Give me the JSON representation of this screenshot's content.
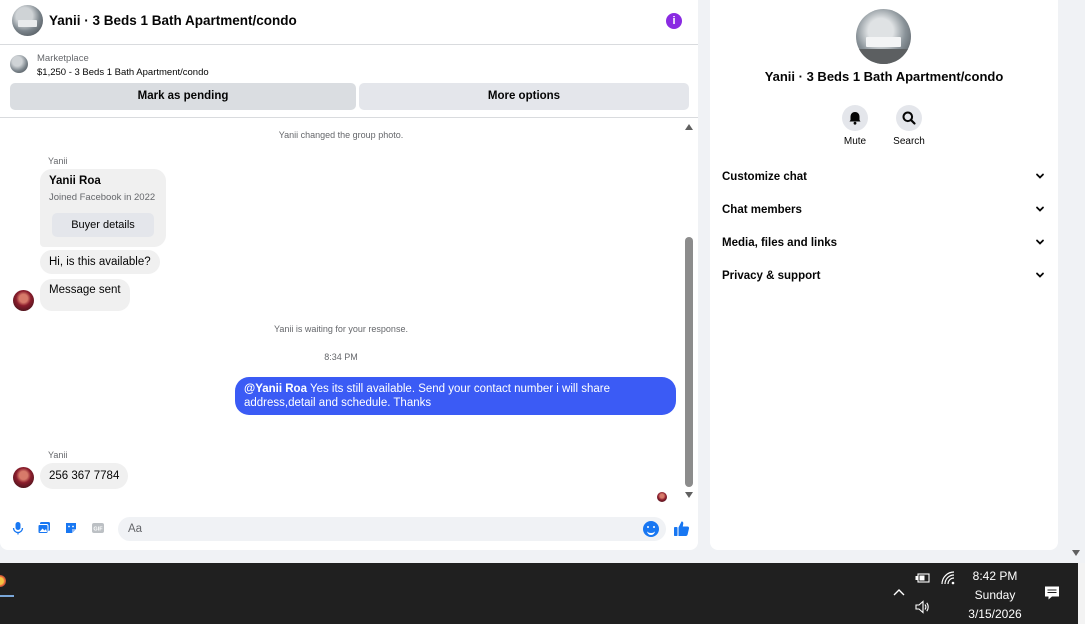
{
  "chat": {
    "title": "Yanii · 3 Beds 1 Bath Apartment/condo",
    "info_icon": "i",
    "listing": {
      "kicker": "Marketplace",
      "price_title": "$1,250 - 3 Beds 1 Bath Apartment/condo",
      "pending_label": "Mark as pending",
      "more_label": "More options"
    },
    "messages": {
      "group_photo_note": "Yanii changed the group photo.",
      "sender_1": "Yanii",
      "profile_name": "Yanii Roa",
      "profile_joined": "Joined Facebook in 2022",
      "buyer_details": "Buyer details",
      "msg_available": "Hi, is this available?",
      "msg_sent": "Message sent",
      "waiting_note": "Yanii is waiting for your response.",
      "time": "8:34 PM",
      "out_mention": "@Yanii Roa",
      "out_text": " Yes its still available. Send your contact number i will share address,detail and schedule. Thanks",
      "sender_2": "Yanii",
      "msg_phone": "256 367 7784"
    },
    "composer": {
      "placeholder": "Aa",
      "icons": [
        "microphone-icon",
        "photo-icon",
        "sticker-icon",
        "gif-icon",
        "emoji-icon",
        "like-icon"
      ]
    },
    "colors": {
      "accent": "#3b5bf5",
      "info": "#8a2be2",
      "emoji": "#1877f2"
    }
  },
  "info": {
    "title": "Yanii · 3 Beds 1 Bath Apartment/condo",
    "mute_label": "Mute",
    "search_label": "Search",
    "sections": [
      {
        "label": "Customize chat"
      },
      {
        "label": "Chat members"
      },
      {
        "label": "Media, files and links"
      },
      {
        "label": "Privacy & support"
      }
    ]
  },
  "taskbar": {
    "time": "8:42 PM",
    "day": "Sunday",
    "date": "3/15/2026",
    "icons": [
      "chevron-up-icon",
      "battery-icon",
      "wifi-icon",
      "volume-icon",
      "notification-icon"
    ]
  }
}
